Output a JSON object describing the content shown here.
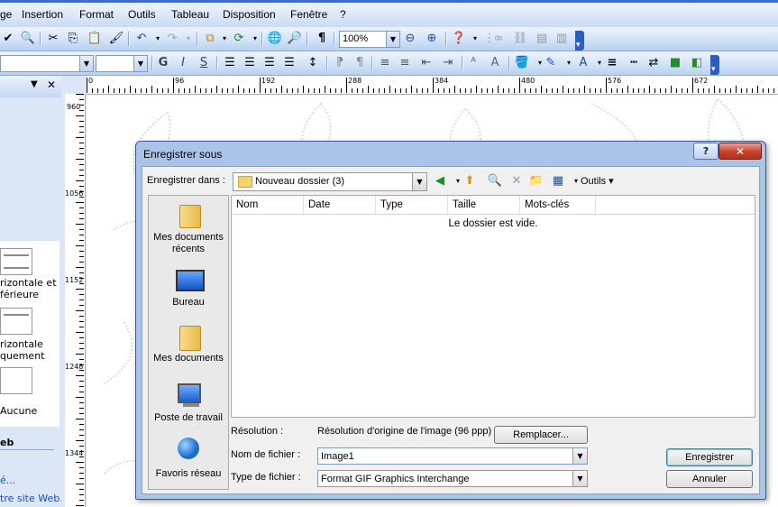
{
  "menu": {
    "items": [
      "ge",
      "Insertion",
      "Format",
      "Outils",
      "Tableau",
      "Disposition",
      "Fenêtre",
      "?"
    ]
  },
  "toolbar": {
    "zoom": "100%"
  },
  "formatbar": {
    "bold": "G",
    "italic": "I",
    "strike": "S"
  },
  "ruler": {
    "h_labels": [
      "0",
      "96",
      "192",
      "288",
      "384",
      "480",
      "576",
      "672"
    ],
    "v_labels": [
      "960",
      "1056",
      "1152",
      "1248",
      "1344"
    ]
  },
  "taskpane": {
    "items": [
      {
        "line1": "rizontale et",
        "line2": "férieure"
      },
      {
        "line1": "rizontale",
        "line2": "quement"
      },
      {
        "line1": "Aucune",
        "line2": ""
      }
    ],
    "section": "eb",
    "link1": "é...",
    "link2": "tre site Web..."
  },
  "dialog": {
    "title": "Enregistrer sous",
    "help": "?",
    "close": "✕",
    "lookin_label": "Enregistrer dans :",
    "lookin_value": "Nouveau dossier (3)",
    "tools_label": "Outils",
    "places": [
      "Mes documents récents",
      "Bureau",
      "Mes documents",
      "Poste de travail",
      "Favoris réseau"
    ],
    "columns": [
      "Nom",
      "Date",
      "Type",
      "Taille",
      "Mots-clés"
    ],
    "empty_message": "Le dossier est vide.",
    "resolution_label": "Résolution :",
    "resolution_value": "Résolution d'origine de l'image (96 ppp)",
    "replace_button": "Remplacer...",
    "filename_label": "Nom de fichier :",
    "filename_value": "Image1",
    "filetype_label": "Type de fichier :",
    "filetype_value": "Format GIF Graphics Interchange",
    "save_button": "Enregistrer",
    "cancel_button": "Annuler"
  }
}
